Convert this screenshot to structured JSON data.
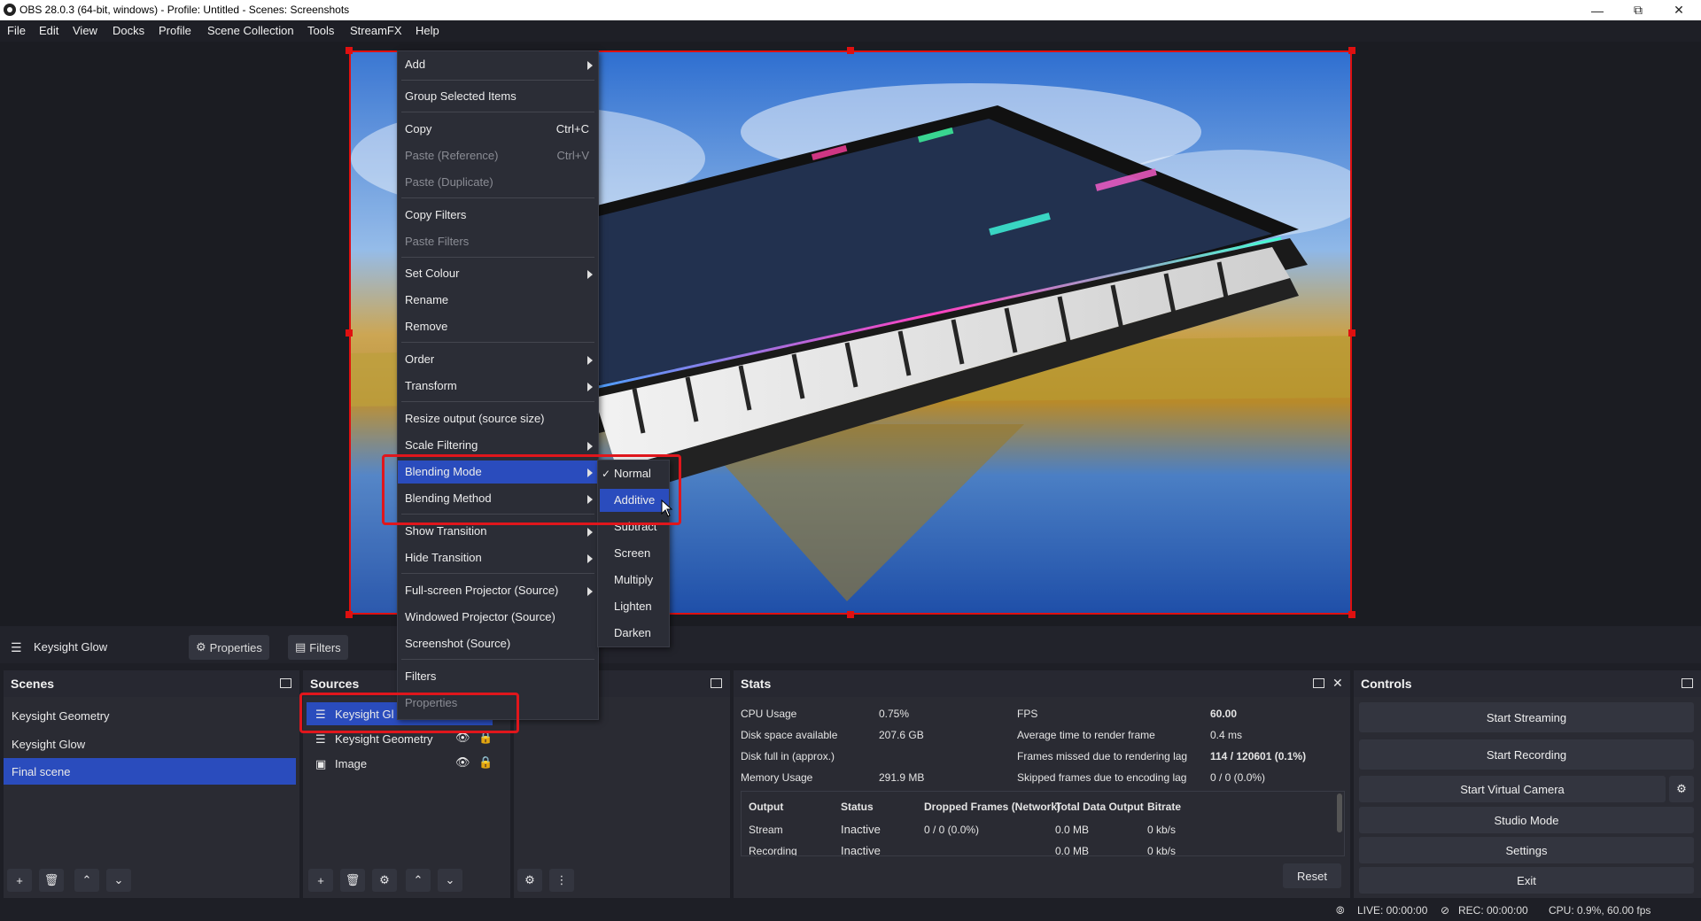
{
  "window": {
    "title": "OBS 28.0.3 (64-bit, windows) - Profile: Untitled - Scenes: Screenshots"
  },
  "menubar": [
    "File",
    "Edit",
    "View",
    "Docks",
    "Profile",
    "Scene Collection",
    "Tools",
    "StreamFX",
    "Help"
  ],
  "context_menu": {
    "add": "Add",
    "group_selected": "Group Selected Items",
    "copy": "Copy",
    "copy_sc": "Ctrl+C",
    "paste_ref": "Paste (Reference)",
    "paste_ref_sc": "Ctrl+V",
    "paste_dup": "Paste (Duplicate)",
    "copy_filters": "Copy Filters",
    "paste_filters": "Paste Filters",
    "set_colour": "Set Colour",
    "rename": "Rename",
    "remove": "Remove",
    "order": "Order",
    "transform": "Transform",
    "resize_output": "Resize output (source size)",
    "scale_filtering": "Scale Filtering",
    "blending_mode": "Blending Mode",
    "blending_method": "Blending Method",
    "show_transition": "Show Transition",
    "hide_transition": "Hide Transition",
    "fullscreen_projector": "Full-screen Projector (Source)",
    "windowed_projector": "Windowed Projector (Source)",
    "screenshot": "Screenshot (Source)",
    "filters": "Filters",
    "properties": "Properties"
  },
  "blending_submenu": {
    "items": [
      "Normal",
      "Additive",
      "Subtract",
      "Screen",
      "Multiply",
      "Lighten",
      "Darken"
    ],
    "checked": "Normal",
    "highlighted": "Additive"
  },
  "source_toolbar": {
    "source_name": "Keysight Glow",
    "properties": "Properties",
    "filters": "Filters"
  },
  "scenes": {
    "title": "Scenes",
    "items": [
      "Keysight Geometry",
      "Keysight Glow",
      "Final scene"
    ],
    "selected": "Final scene"
  },
  "sources": {
    "title": "Sources",
    "items": [
      "Keysight Glow",
      "Keysight Geometry",
      "Image"
    ],
    "visible_first": "Keysight Gl"
  },
  "stats": {
    "title": "Stats",
    "cpu_usage_label": "CPU Usage",
    "cpu_usage": "0.75%",
    "disk_space_label": "Disk space available",
    "disk_space": "207.6 GB",
    "disk_full_label": "Disk full in (approx.)",
    "disk_full": "",
    "memory_label": "Memory Usage",
    "memory": "291.9 MB",
    "fps_label": "FPS",
    "fps": "60.00",
    "render_time_label": "Average time to render frame",
    "render_time": "0.4 ms",
    "frames_missed_label": "Frames missed due to rendering lag",
    "frames_missed": "114 / 120601 (0.1%)",
    "skipped_label": "Skipped frames due to encoding lag",
    "skipped": "0 / 0 (0.0%)",
    "table_headers": [
      "Output",
      "Status",
      "Dropped Frames (Network)",
      "Total Data Output",
      "Bitrate"
    ],
    "rows": [
      [
        "Stream",
        "Inactive",
        "0 / 0 (0.0%)",
        "0.0 MB",
        "0 kb/s"
      ],
      [
        "Recording",
        "Inactive",
        "",
        "0.0 MB",
        "0 kb/s"
      ]
    ],
    "reset": "Reset"
  },
  "controls": {
    "title": "Controls",
    "start_streaming": "Start Streaming",
    "start_recording": "Start Recording",
    "start_virtual_camera": "Start Virtual Camera",
    "studio_mode": "Studio Mode",
    "settings": "Settings",
    "exit": "Exit"
  },
  "statusbar": {
    "live": "LIVE: 00:00:00",
    "rec": "REC: 00:00:00",
    "cpu": "CPU: 0.9%, 60.00 fps"
  },
  "colors": {
    "accent": "#2a4cbd",
    "highlight_red": "#e0161c",
    "panel": "#2a2b33"
  }
}
